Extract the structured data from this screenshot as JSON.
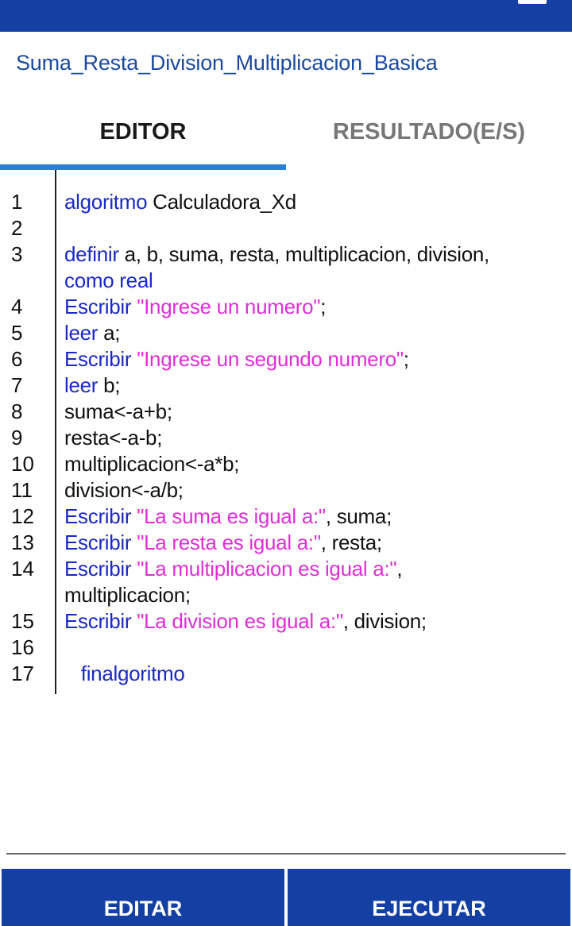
{
  "app": {
    "file_title": "Suma_Resta_Division_Multiplicacion_Basica"
  },
  "tabs": {
    "editor": "EDITOR",
    "result": "RESULTADO(E/S)"
  },
  "code_lines": [
    {
      "n": "1",
      "segments": [
        {
          "t": "algoritmo",
          "c": "kw"
        },
        {
          "t": " Calculadora_Xd",
          "c": "plain"
        }
      ]
    },
    {
      "n": "2",
      "segments": []
    },
    {
      "n": "3",
      "segments": [
        {
          "t": "definir",
          "c": "kw"
        },
        {
          "t": " a, b, suma, resta, multiplicacion, division,",
          "c": "plain"
        }
      ]
    },
    {
      "n": "",
      "segments": [
        {
          "t": "como real",
          "c": "kw"
        }
      ]
    },
    {
      "n": "4",
      "segments": [
        {
          "t": "Escribir",
          "c": "kw"
        },
        {
          "t": " \"Ingrese un numero\"",
          "c": "str"
        },
        {
          "t": ";",
          "c": "plain"
        }
      ]
    },
    {
      "n": "5",
      "segments": [
        {
          "t": "leer",
          "c": "kw"
        },
        {
          "t": " a;",
          "c": "plain"
        }
      ]
    },
    {
      "n": "6",
      "segments": [
        {
          "t": "Escribir",
          "c": "kw"
        },
        {
          "t": " \"Ingrese un segundo numero\"",
          "c": "str"
        },
        {
          "t": ";",
          "c": "plain"
        }
      ]
    },
    {
      "n": "7",
      "segments": [
        {
          "t": "leer",
          "c": "kw"
        },
        {
          "t": " b;",
          "c": "plain"
        }
      ]
    },
    {
      "n": "8",
      "segments": [
        {
          "t": "suma<-a+b;",
          "c": "plain"
        }
      ]
    },
    {
      "n": "9",
      "segments": [
        {
          "t": "resta<-a-b;",
          "c": "plain"
        }
      ]
    },
    {
      "n": "10",
      "segments": [
        {
          "t": "multiplicacion<-a*b;",
          "c": "plain"
        }
      ]
    },
    {
      "n": "11",
      "segments": [
        {
          "t": "division<-a/b;",
          "c": "plain"
        }
      ]
    },
    {
      "n": "12",
      "segments": [
        {
          "t": "Escribir",
          "c": "kw"
        },
        {
          "t": " \"La suma es igual a:\"",
          "c": "str"
        },
        {
          "t": ", suma;",
          "c": "plain"
        }
      ]
    },
    {
      "n": "13",
      "segments": [
        {
          "t": "Escribir",
          "c": "kw"
        },
        {
          "t": " \"La resta es igual a:\"",
          "c": "str"
        },
        {
          "t": ", resta;",
          "c": "plain"
        }
      ]
    },
    {
      "n": "14",
      "segments": [
        {
          "t": "Escribir",
          "c": "kw"
        },
        {
          "t": " \"La multiplicacion es igual a:\"",
          "c": "str"
        },
        {
          "t": ",",
          "c": "plain"
        }
      ]
    },
    {
      "n": "",
      "segments": [
        {
          "t": "multiplicacion;",
          "c": "plain"
        }
      ]
    },
    {
      "n": "15",
      "segments": [
        {
          "t": "Escribir",
          "c": "kw"
        },
        {
          "t": " \"La division es igual a:\"",
          "c": "str"
        },
        {
          "t": ", division;",
          "c": "plain"
        }
      ]
    },
    {
      "n": "16",
      "segments": []
    },
    {
      "n": "17",
      "segments": [
        {
          "t": "   finalgoritmo",
          "c": "kw"
        }
      ]
    }
  ],
  "buttons": {
    "edit": "EDITAR",
    "run": "EJECUTAR"
  },
  "colors": {
    "bar": "#1440a4",
    "keyword": "#1a29c7",
    "string": "#e02ed7",
    "tab_indicator": "#2b7fd6"
  },
  "icons": {
    "menu": "menu-icon"
  }
}
